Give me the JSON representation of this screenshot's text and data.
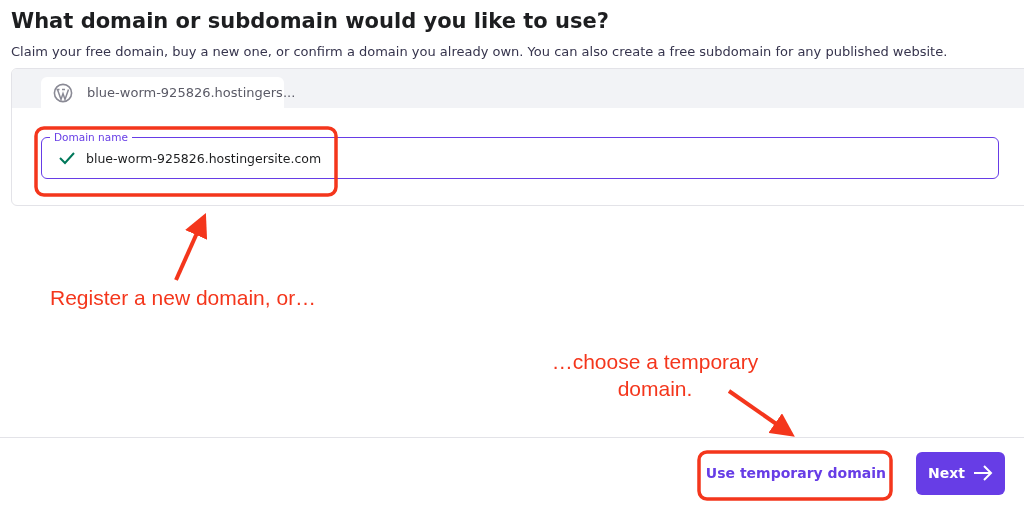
{
  "heading": "What domain or subdomain would you like to use?",
  "subtitle": "Claim your free domain, buy a new one, or confirm a domain you already own. You can also create a free subdomain for any published website.",
  "tabs": [
    {
      "label": "blue-worm-925826.hostingers...",
      "selected": true
    }
  ],
  "domain_field": {
    "label": "Domain name",
    "value": "blue-worm-925826.hostingersite.com",
    "valid": true
  },
  "buttons": [
    {
      "kind": "link",
      "label": "Use temporary domain"
    },
    {
      "kind": "primary",
      "label": "Next"
    }
  ],
  "annotations": [
    {
      "text": "Register a new domain, or…"
    },
    {
      "text": "…choose a temporary domain."
    }
  ]
}
